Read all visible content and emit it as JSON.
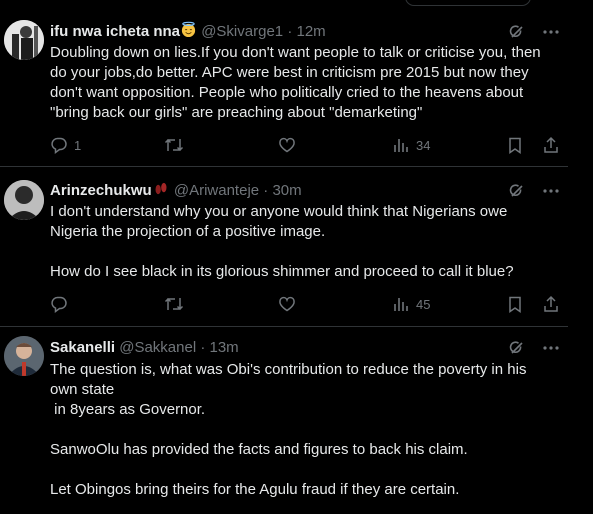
{
  "tweets": [
    {
      "name": "ifu nwa icheta nna",
      "handle": "@Skivarge1",
      "sep": "·",
      "time": "12m",
      "text": "Doubling down on lies.If you don't want people to talk or criticise you, then do your jobs,do better. APC were best in criticism pre 2015 but now they don't want opposition. People who politically cried to the heavens about \"bring back our girls\" are preaching about \"demarketing\"",
      "replies": "1",
      "retweets": "",
      "likes": "",
      "views": "34"
    },
    {
      "name": "Arinzechukwu",
      "handle": "@Ariwanteje",
      "sep": "·",
      "time": "30m",
      "text": "I don't understand why you or anyone would think that Nigerians owe Nigeria the projection of a positive image.\n\nHow do I see black in its glorious shimmer and proceed to call it blue?",
      "replies": "",
      "retweets": "",
      "likes": "",
      "views": "45"
    },
    {
      "name": "Sakanelli",
      "handle": "@Sakkanel",
      "sep": "·",
      "time": "13m",
      "text": "The question is, what was Obi's contribution to reduce the poverty in his own state\n in 8years as Governor.\n\nSanwoOlu has provided the facts and figures to back his claim.\n\nLet Obingos bring theirs for the Agulu fraud if they are certain."
    }
  ],
  "icons": {
    "reply": "reply-icon",
    "retweet": "retweet-icon",
    "like": "heart-icon",
    "views": "views-icon",
    "bookmark": "bookmark-icon",
    "share": "share-icon",
    "grok": "grok-icon",
    "more": "more-icon"
  },
  "colors": {
    "background": "#000000",
    "text": "#e7e9ea",
    "secondary": "#71767b",
    "divider": "#2f3336"
  }
}
